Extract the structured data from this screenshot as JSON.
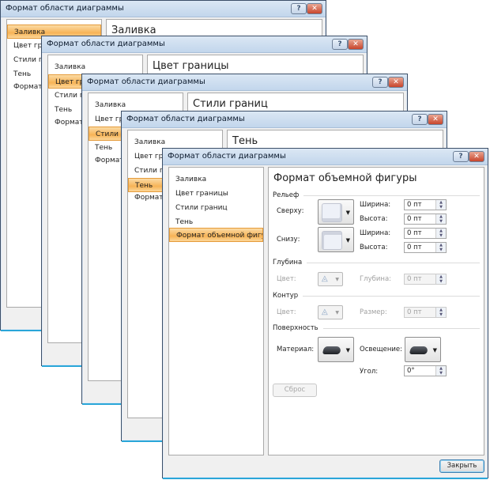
{
  "dialog_title": "Формат области диаграммы",
  "title_buttons": {
    "help": "?",
    "close": "✕"
  },
  "nav_items": [
    "Заливка",
    "Цвет границы",
    "Стили границ",
    "Тень",
    "Формат объемной фигуры"
  ],
  "windows": [
    {
      "heading": "Заливка",
      "selected": 0
    },
    {
      "heading": "Цвет границы",
      "selected": 1
    },
    {
      "heading": "Стили границ",
      "selected": 2
    },
    {
      "heading": "Тень",
      "selected": 3
    },
    {
      "heading": "Формат объемной фигуры",
      "selected": 4
    }
  ],
  "front": {
    "relief": {
      "label": "Рельеф",
      "top_label": "Сверху:",
      "bottom_label": "Снизу:",
      "width_label": "Ширина:",
      "height_label": "Высота:",
      "top_width": "0 пт",
      "top_height": "0 пт",
      "bottom_width": "0 пт",
      "bottom_height": "0 пт"
    },
    "depth": {
      "label": "Глубина",
      "color_label": "Цвет:",
      "depth_label": "Глубина:",
      "depth_value": "0 пт"
    },
    "contour": {
      "label": "Контур",
      "color_label": "Цвет:",
      "size_label": "Размер:",
      "size_value": "0 пт"
    },
    "surface": {
      "label": "Поверхность",
      "material_label": "Материал:",
      "lighting_label": "Освещение:",
      "angle_label": "Угол:",
      "angle_value": "0°"
    },
    "reset_label": "Сброс",
    "close_label": "Закрыть"
  },
  "icons": {
    "dropdown": "▼",
    "spin_up": "▲",
    "spin_down": "▼",
    "bucket": "🪣"
  }
}
